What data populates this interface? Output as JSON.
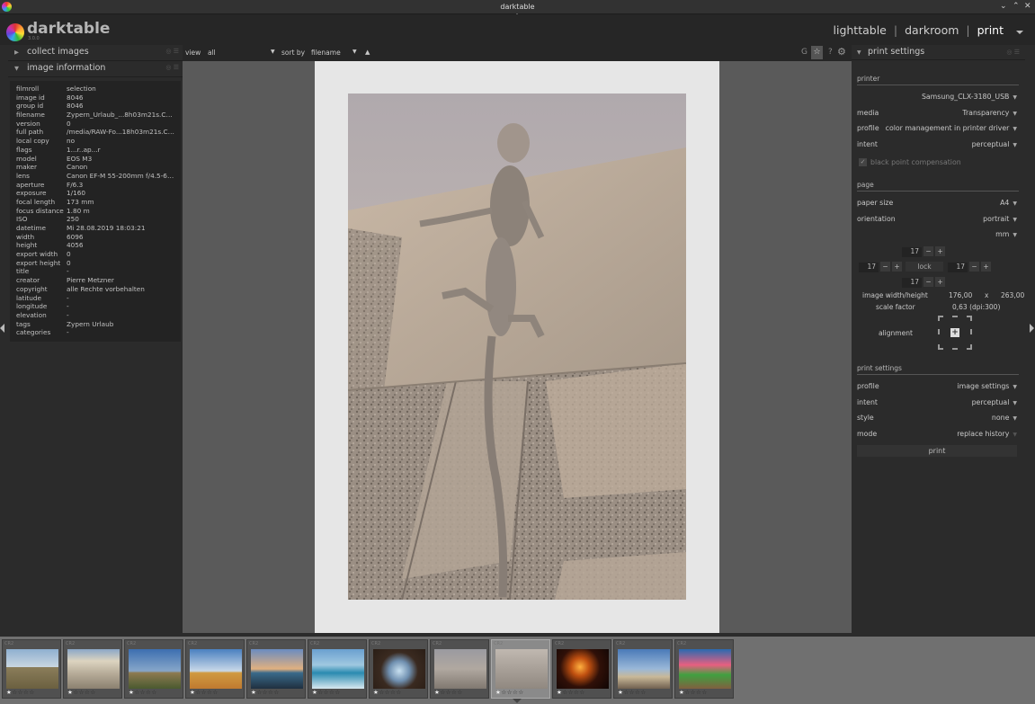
{
  "window": {
    "title": "darktable"
  },
  "app": {
    "name": "darktable",
    "version": "3.0.0"
  },
  "views": {
    "lighttable": "lighttable",
    "darkroom": "darkroom",
    "print": "print",
    "sep": "|"
  },
  "left": {
    "collect_label": "collect images",
    "info_label": "image information",
    "info": [
      {
        "k": "filmroll",
        "v": "selection"
      },
      {
        "k": "image id",
        "v": "8046"
      },
      {
        "k": "group id",
        "v": "8046"
      },
      {
        "k": "filename",
        "v": "Zypern_Urlaub_...8h03m21s.CR2"
      },
      {
        "k": "version",
        "v": "0"
      },
      {
        "k": "full path",
        "v": "/media/RAW-Fo...18h03m21s.CR2"
      },
      {
        "k": "local copy",
        "v": "no"
      },
      {
        "k": "flags",
        "v": "1...r..ap...r"
      },
      {
        "k": "model",
        "v": "EOS M3"
      },
      {
        "k": "maker",
        "v": "Canon"
      },
      {
        "k": "lens",
        "v": "Canon EF-M 55-200mm f/4.5-6...."
      },
      {
        "k": "aperture",
        "v": "F/6.3"
      },
      {
        "k": "exposure",
        "v": "1/160"
      },
      {
        "k": "focal length",
        "v": "173 mm"
      },
      {
        "k": "focus distance",
        "v": "1.80 m"
      },
      {
        "k": "ISO",
        "v": "250"
      },
      {
        "k": "datetime",
        "v": "Mi 28.08.2019 18:03:21"
      },
      {
        "k": "width",
        "v": "6096"
      },
      {
        "k": "height",
        "v": "4056"
      },
      {
        "k": "export width",
        "v": "0"
      },
      {
        "k": "export height",
        "v": "0"
      },
      {
        "k": "title",
        "v": "-"
      },
      {
        "k": "creator",
        "v": "Pierre Metzner"
      },
      {
        "k": "copyright",
        "v": "alle Rechte vorbehalten"
      },
      {
        "k": "latitude",
        "v": "-"
      },
      {
        "k": "longitude",
        "v": "-"
      },
      {
        "k": "elevation",
        "v": "-"
      },
      {
        "k": "tags",
        "v": "Zypern Urlaub"
      },
      {
        "k": "categories",
        "v": "-"
      }
    ]
  },
  "toolbar": {
    "view_label": "view",
    "view_value": "all",
    "sort_label": "sort by",
    "sort_value": "filename",
    "sort_dir": "▲"
  },
  "right": {
    "module_title": "print settings",
    "printer_section": "printer",
    "printer": "Samsung_CLX-3180_USB",
    "media_k": "media",
    "media_v": "Transparency",
    "profile_k": "profile",
    "profile_v": "color management in printer driver",
    "intent_k": "intent",
    "intent_v": "perceptual",
    "bpc": "black point compensation",
    "page_section": "page",
    "paper_k": "paper size",
    "paper_v": "A4",
    "orient_k": "orientation",
    "orient_v": "portrait",
    "unit": "mm",
    "margin_top": "17",
    "margin_left": "17",
    "margin_right": "17",
    "margin_bottom": "17",
    "lock": "lock",
    "imgwh_k": "image width/height",
    "img_w": "176,00",
    "img_x": "x",
    "img_h": "263,00",
    "scale_k": "scale factor",
    "scale_v": "0,63 (dpi:300)",
    "align_k": "alignment",
    "ps_section": "print settings",
    "ps_profile_k": "profile",
    "ps_profile_v": "image settings",
    "ps_intent_k": "intent",
    "ps_intent_v": "perceptual",
    "style_k": "style",
    "style_v": "none",
    "mode_k": "mode",
    "mode_v": "replace history",
    "print_button": "print"
  },
  "filmstrip": [
    {
      "ext": "CR2",
      "stars": 1
    },
    {
      "ext": "CR2",
      "stars": 1
    },
    {
      "ext": "CR2",
      "stars": 1
    },
    {
      "ext": "CR2",
      "stars": 1
    },
    {
      "ext": "CR2",
      "stars": 1
    },
    {
      "ext": "CR2",
      "stars": 1
    },
    {
      "ext": "CR2",
      "stars": 1
    },
    {
      "ext": "CR2",
      "stars": 1
    },
    {
      "ext": "CR2",
      "stars": 1
    },
    {
      "ext": "CR2",
      "stars": 1
    },
    {
      "ext": "CR2",
      "stars": 1
    },
    {
      "ext": "CR2",
      "stars": 1
    }
  ]
}
